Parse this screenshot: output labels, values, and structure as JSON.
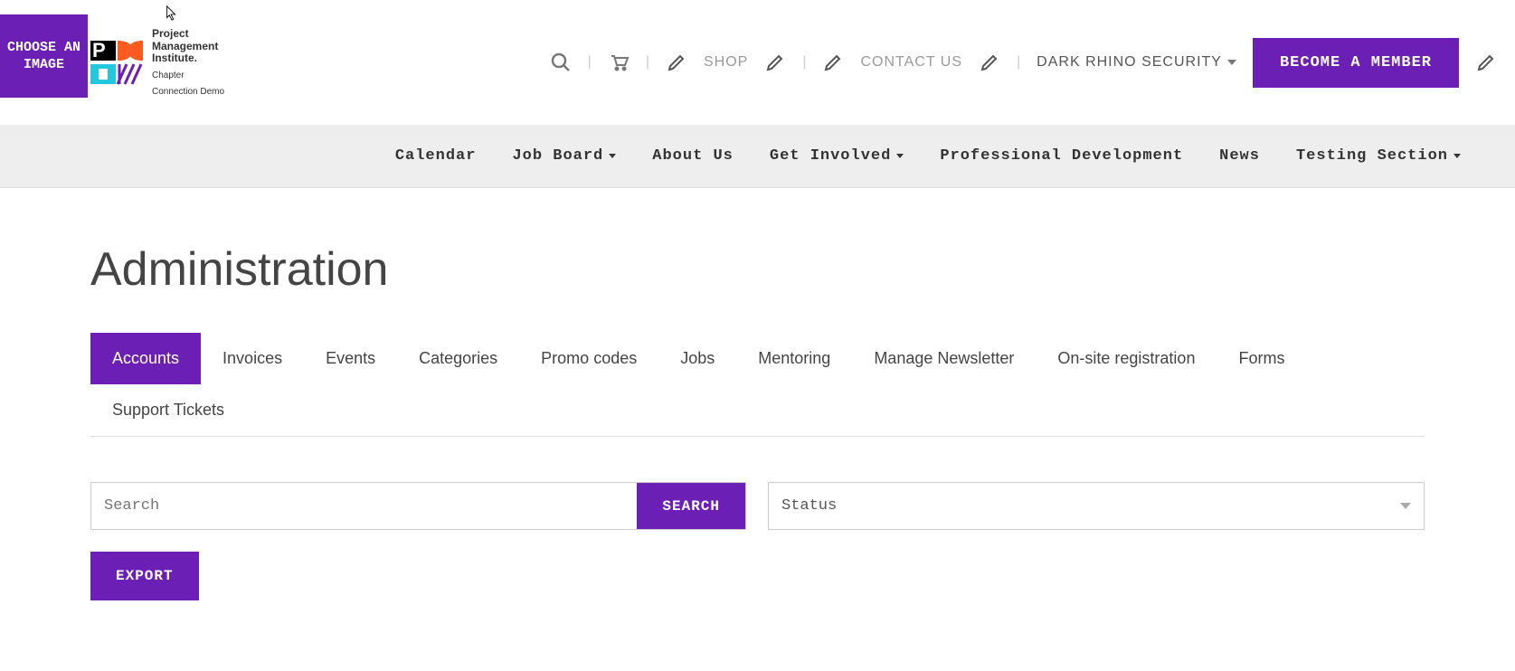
{
  "choose_image_label": "CHOOSE AN IMAGE",
  "logo": {
    "line1a": "Project",
    "line1b": "Management",
    "line1c": "Institute.",
    "line2a": "Chapter",
    "line2b": "Connection Demo"
  },
  "top_nav": {
    "shop": "SHOP",
    "contact": "CONTACT US",
    "user": "DARK RHINO SECURITY",
    "member_btn": "BECOME A MEMBER"
  },
  "main_nav": {
    "calendar": "Calendar",
    "job_board": "Job Board",
    "about": "About Us",
    "get_involved": "Get Involved",
    "prof_dev": "Professional Development",
    "news": "News",
    "testing": "Testing Section"
  },
  "page_title": "Administration",
  "tabs": {
    "accounts": "Accounts",
    "invoices": "Invoices",
    "events": "Events",
    "categories": "Categories",
    "promo": "Promo codes",
    "jobs": "Jobs",
    "mentoring": "Mentoring",
    "newsletter": "Manage Newsletter",
    "onsite": "On-site registration",
    "forms": "Forms",
    "tickets": "Support Tickets"
  },
  "search": {
    "placeholder": "Search",
    "button": "SEARCH",
    "status_label": "Status"
  },
  "export_btn": "EXPORT"
}
